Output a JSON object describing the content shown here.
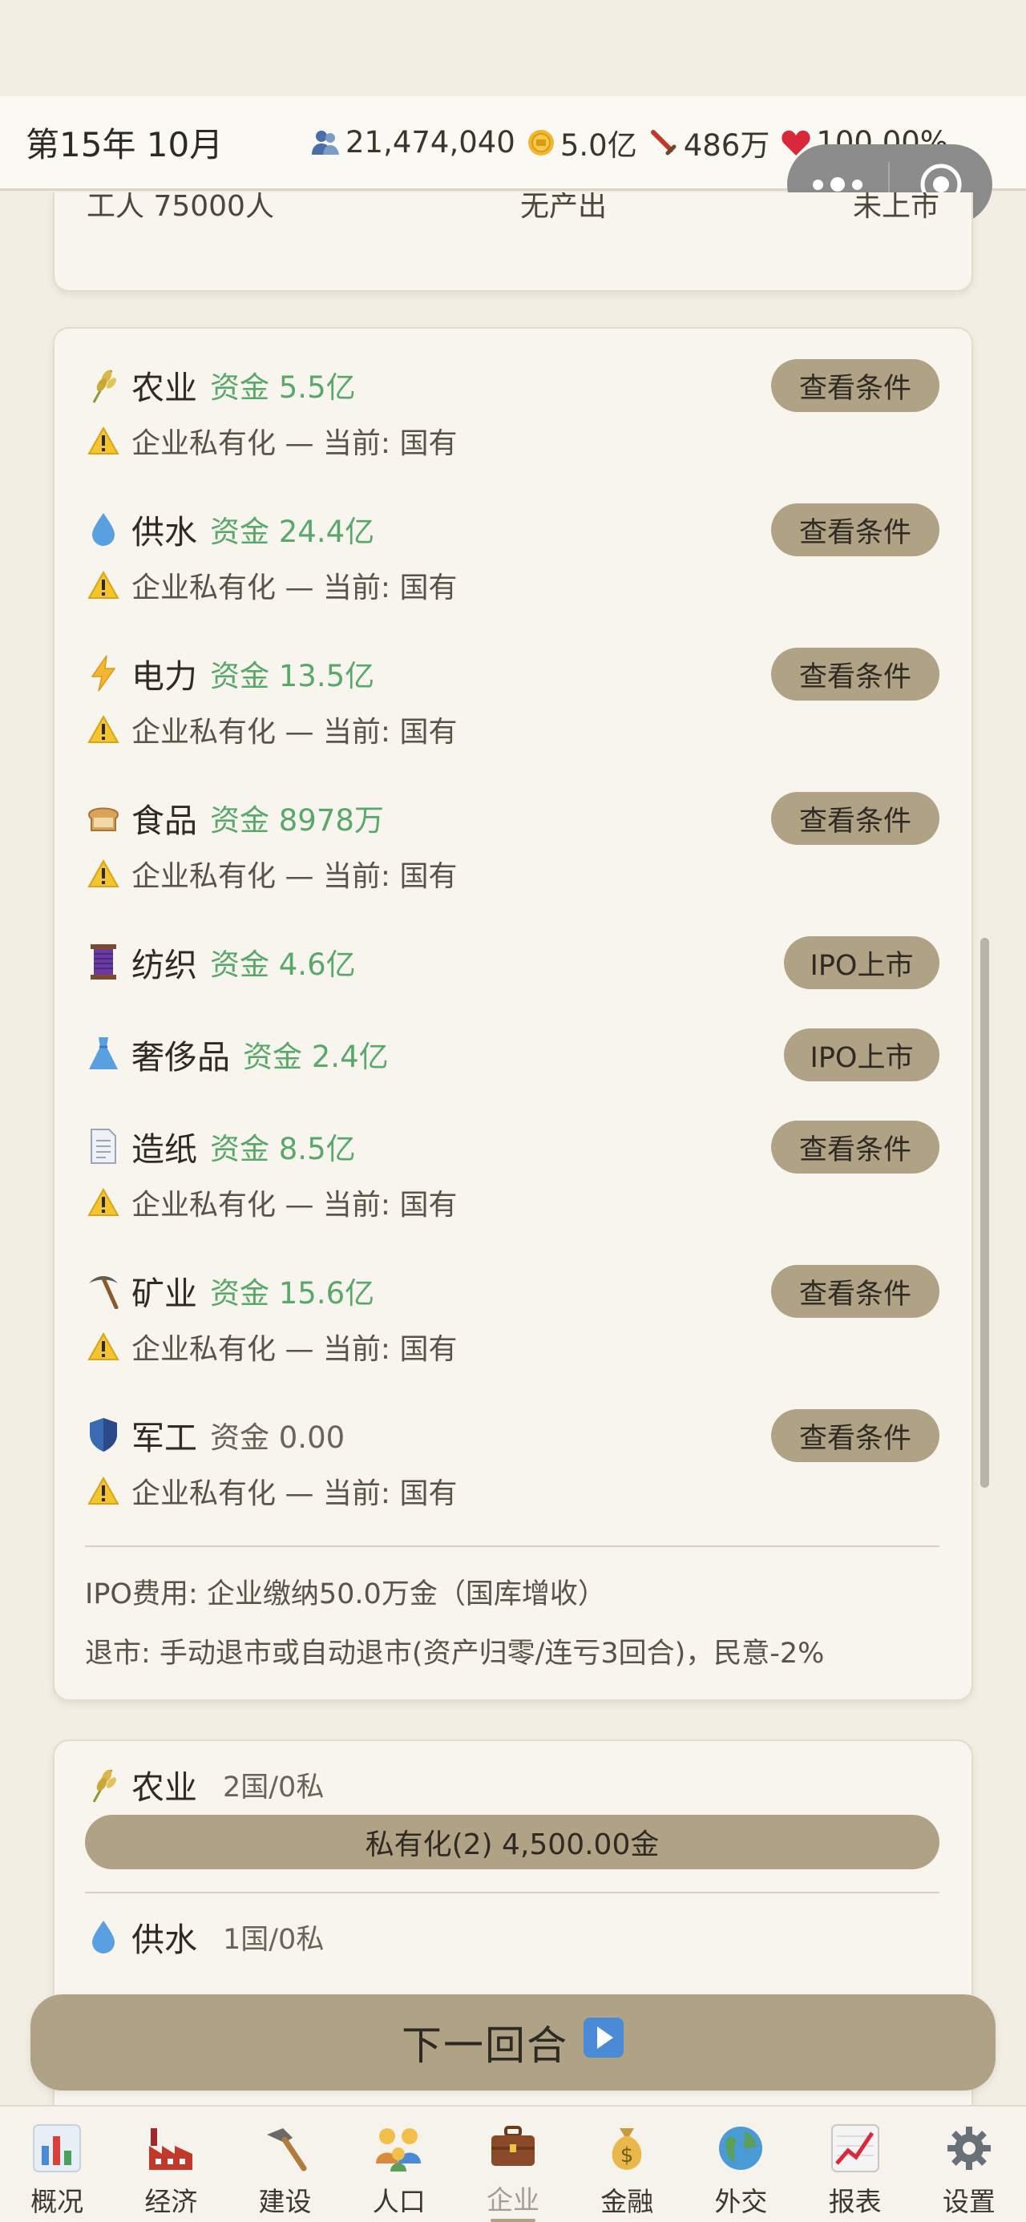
{
  "header": {
    "date": "第15年 10月",
    "population": "21,474,040",
    "treasury": "5.0亿",
    "military": "486万",
    "approval": "100.00%"
  },
  "top_card": {
    "col1": "工人 75000人",
    "col2": "无产出",
    "col3": "未上市"
  },
  "enterprises": [
    {
      "icon": "wheat-icon",
      "name": "农业",
      "fund": "资金 5.5亿",
      "button": "查看条件",
      "warning": "企业私有化 — 当前: 国有"
    },
    {
      "icon": "water-drop-icon",
      "name": "供水",
      "fund": "资金 24.4亿",
      "button": "查看条件",
      "warning": "企业私有化 — 当前: 国有"
    },
    {
      "icon": "lightning-icon",
      "name": "电力",
      "fund": "资金 13.5亿",
      "button": "查看条件",
      "warning": "企业私有化 — 当前: 国有"
    },
    {
      "icon": "bread-icon",
      "name": "食品",
      "fund": "资金 8978万",
      "button": "查看条件",
      "warning": "企业私有化 — 当前: 国有"
    },
    {
      "icon": "thread-spool-icon",
      "name": "纺织",
      "fund": "资金 4.6亿",
      "button": "IPO上市"
    },
    {
      "icon": "dress-icon",
      "name": "奢侈品",
      "fund": "资金 2.4亿",
      "button": "IPO上市"
    },
    {
      "icon": "document-icon",
      "name": "造纸",
      "fund": "资金 8.5亿",
      "button": "查看条件",
      "warning": "企业私有化 — 当前: 国有"
    },
    {
      "icon": "pickaxe-icon",
      "name": "矿业",
      "fund": "资金 15.6亿",
      "button": "查看条件",
      "warning": "企业私有化 — 当前: 国有"
    },
    {
      "icon": "shield-icon",
      "name": "军工",
      "fund": "资金 0.00",
      "button": "查看条件",
      "warning": "企业私有化 — 当前: 国有"
    }
  ],
  "notes": {
    "ipo_fee": "IPO费用: 企业缴纳50.0万金（国库增收）",
    "delist": "退市: 手动退市或自动退市(资产归零/连亏3回合)，民意-2%"
  },
  "industries": [
    {
      "icon": "wheat-icon",
      "name": "农业",
      "count": "2国/0私",
      "action": "私有化(2) 4,500.00金"
    },
    {
      "icon": "water-drop-icon",
      "name": "供水",
      "count": "1国/0私"
    }
  ],
  "next_turn": "下一回合",
  "tabs": [
    {
      "icon": "bar-chart-icon",
      "label": "概况"
    },
    {
      "icon": "factory-icon",
      "label": "经济"
    },
    {
      "icon": "hammer-icon",
      "label": "建设"
    },
    {
      "icon": "family-icon",
      "label": "人口"
    },
    {
      "icon": "briefcase-icon",
      "label": "企业",
      "active": true
    },
    {
      "icon": "money-bag-icon",
      "label": "金融"
    },
    {
      "icon": "globe-icon",
      "label": "外交"
    },
    {
      "icon": "trend-chart-icon",
      "label": "报表"
    },
    {
      "icon": "gear-icon",
      "label": "设置"
    }
  ],
  "colors": {
    "background": "#f2eee4",
    "button": "#b0a285",
    "fund_green": "#58a86a"
  }
}
